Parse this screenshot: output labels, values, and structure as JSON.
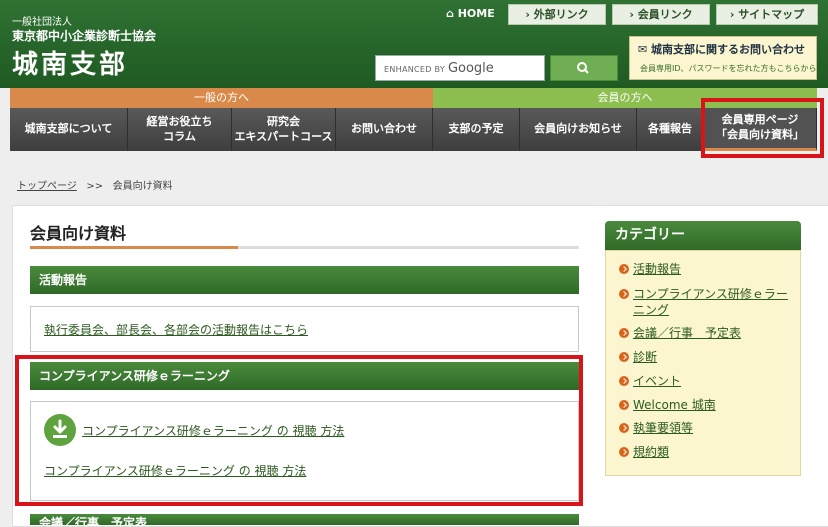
{
  "header": {
    "org_line1": "一般社団法人",
    "org_line2": "東京都中小企業診断士協会",
    "branch_name": "城南支部",
    "home_label": "HOME",
    "top_links": [
      "外部リンク",
      "会員リンク",
      "サイトマップ"
    ],
    "search_enhanced": "ENHANCED BY",
    "search_brand": "Google",
    "inquiry_main": "城南支部に関するお問い合わせ",
    "inquiry_sub": "会員専用ID、パスワードを忘れた方もこちらから"
  },
  "nav": {
    "general_heading": "一般の方へ",
    "member_heading": "会員の方へ",
    "items": [
      "城南支部について",
      "経営お役立ち\nコラム",
      "研究会\nエキスパートコース",
      "お問い合わせ",
      "支部の予定",
      "会員向けお知らせ",
      "各種報告",
      "会員専用ページ\n「会員向け資料」"
    ]
  },
  "breadcrumb": {
    "home": "トップページ",
    "separator": ">>",
    "current": "会員向け資料"
  },
  "main": {
    "title": "会員向け資料",
    "sections": [
      {
        "heading": "活動報告",
        "links": [
          "執行委員会、部長会、各部会の活動報告はこちら"
        ]
      },
      {
        "heading": "コンプライアンス研修ｅラーニング",
        "links": [
          "コンプライアンス研修ｅラーニング の 視聴 方法",
          "コンプライアンス研修ｅラーニング の 視聴 方法"
        ]
      },
      {
        "heading": "会議／行事　予定表"
      }
    ]
  },
  "sidebar": {
    "heading": "カテゴリー",
    "items": [
      "活動報告",
      "コンプライアンス研修ｅラーニング",
      "会議／行事　予定表",
      "診断",
      "イベント",
      "Welcome 城南",
      "執筆要領等",
      "規約類"
    ]
  },
  "colors": {
    "primary_green": "#2f6a27",
    "accent_orange": "#d98a4a",
    "highlight_red": "#d8141b",
    "member_green": "#8cbf4f"
  }
}
